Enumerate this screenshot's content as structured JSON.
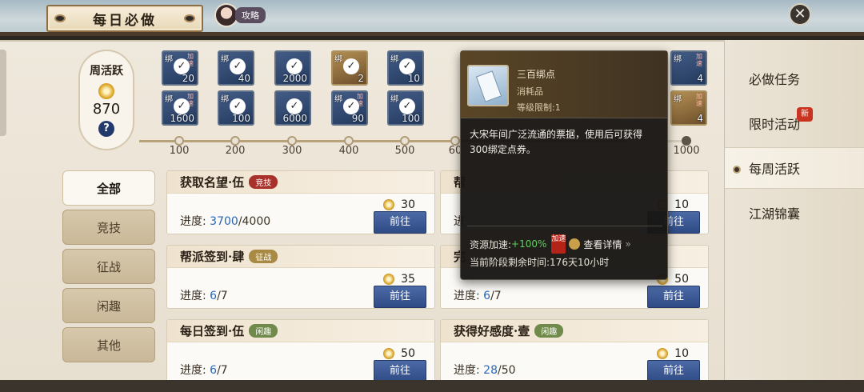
{
  "header": {
    "title": "每日必做",
    "guide_label": "攻略",
    "close_symbol": "✕"
  },
  "activity": {
    "label": "周活跃",
    "value": "870",
    "help_symbol": "?"
  },
  "rewards_row1": [
    {
      "bind": "绑",
      "speed": "加速",
      "qty": "20",
      "claimed": true,
      "style": "blue"
    },
    {
      "bind": "绑",
      "speed": "",
      "qty": "40",
      "claimed": true,
      "style": "blue"
    },
    {
      "bind": "",
      "speed": "",
      "qty": "2000",
      "claimed": true,
      "style": "blue"
    },
    {
      "bind": "绑",
      "speed": "",
      "qty": "2",
      "claimed": true,
      "style": "gold"
    },
    {
      "bind": "绑",
      "speed": "",
      "qty": "10",
      "claimed": true,
      "style": "blue"
    },
    {
      "bind": "绑",
      "speed": "加速",
      "qty": "4",
      "claimed": false,
      "style": "blue"
    }
  ],
  "rewards_row2": [
    {
      "bind": "绑",
      "speed": "加速",
      "qty": "1600",
      "claimed": true,
      "style": "blue"
    },
    {
      "bind": "绑",
      "speed": "",
      "qty": "100",
      "claimed": true,
      "style": "blue"
    },
    {
      "bind": "",
      "speed": "",
      "qty": "6000",
      "claimed": true,
      "style": "blue"
    },
    {
      "bind": "绑",
      "speed": "加速",
      "qty": "90",
      "claimed": true,
      "style": "blue"
    },
    {
      "bind": "绑",
      "speed": "",
      "qty": "100",
      "claimed": true,
      "style": "blue"
    },
    {
      "bind": "绑",
      "speed": "加速",
      "qty": "4",
      "claimed": false,
      "style": "gold"
    }
  ],
  "milestones": [
    "100",
    "200",
    "300",
    "400",
    "500",
    "60",
    "1000"
  ],
  "categories": [
    "全部",
    "竞技",
    "征战",
    "闲趣",
    "其他"
  ],
  "tasks": [
    {
      "name": "获取名望·伍",
      "tag": "竞技",
      "tag_color": "red",
      "points": "30",
      "progress_label": "进度:",
      "current": "3700",
      "total": "/4000",
      "button": "前往"
    },
    {
      "name": "帮",
      "tag": "",
      "tag_color": "",
      "points": "10",
      "progress_label": "进",
      "current": "",
      "total": "",
      "button": "前往"
    },
    {
      "name": "帮派签到·肆",
      "tag": "征战",
      "tag_color": "gold",
      "points": "35",
      "progress_label": "进度:",
      "current": "6",
      "total": "/7",
      "button": "前往"
    },
    {
      "name": "完",
      "tag": "",
      "tag_color": "",
      "points": "50",
      "progress_label": "进度:",
      "current": "6",
      "total": "/7",
      "button": "前往"
    },
    {
      "name": "每日签到·伍",
      "tag": "闲趣",
      "tag_color": "green",
      "points": "50",
      "progress_label": "进度:",
      "current": "6",
      "total": "/7",
      "button": "前往"
    },
    {
      "name": "获得好感度·壹",
      "tag": "闲趣",
      "tag_color": "green",
      "points": "10",
      "progress_label": "进度:",
      "current": "28",
      "total": "/50",
      "button": "前往"
    }
  ],
  "right_nav": {
    "items": [
      "必做任务",
      "限时活动",
      "每周活跃",
      "江湖锦囊"
    ],
    "new_badge": "新",
    "active_index": 2
  },
  "tooltip": {
    "item_name": "三百绑点",
    "item_type": "消耗品",
    "level_limit": "等级限制:1",
    "description": "大宋年间广泛流通的票据，使用后可获得300绑定点券。",
    "resource_label": "资源加速:",
    "resource_pct": "+100%",
    "speed_stamp": "加速",
    "detail_link": "查看详情",
    "arrows": "»",
    "remaining": "当前阶段剩余时间:176天10小时"
  },
  "colors": {
    "accent_blue": "#2f4b86",
    "progress_blue": "#2a67b8",
    "green_pct": "#5ed35e",
    "badge_red": "#c9331f"
  }
}
